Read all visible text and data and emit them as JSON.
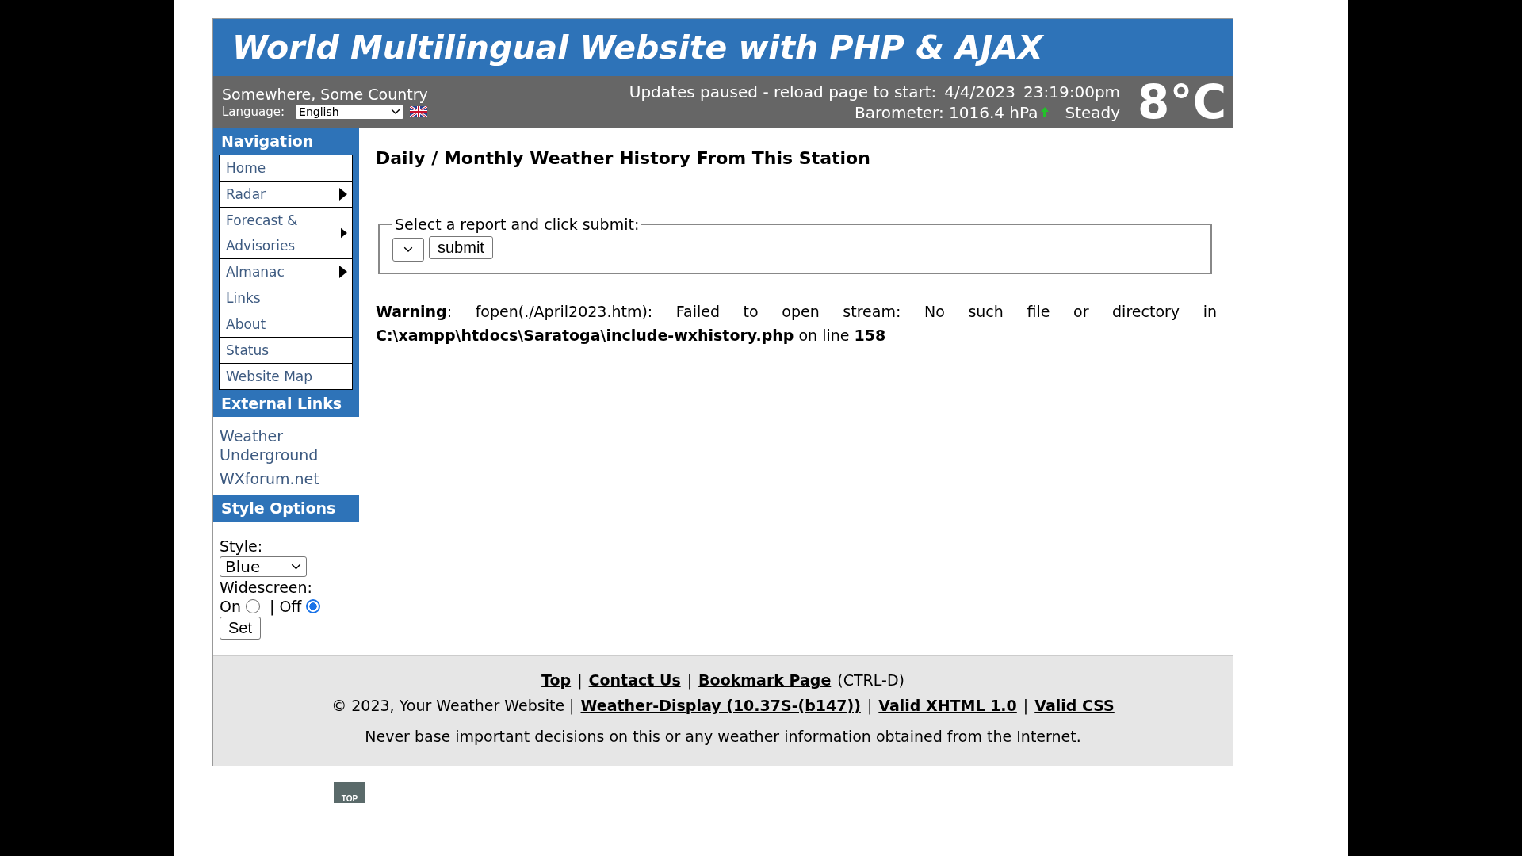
{
  "header": {
    "title": "World Multilingual Website with PHP & AJAX",
    "location": "Somewhere, Some Country",
    "language_label": "Language:",
    "language": "English",
    "status": "Updates paused - reload page to start:",
    "date": "4/4/2023",
    "time": "23:19:00pm",
    "barometer": "Barometer: 1016.4 hPa",
    "trend": "Steady",
    "temperature": "8°C"
  },
  "navigation": {
    "heading": "Navigation",
    "items": [
      {
        "label": "Home",
        "has_submenu": false
      },
      {
        "label": "Radar",
        "has_submenu": true
      },
      {
        "label": "Forecast & Advisories",
        "has_submenu": true
      },
      {
        "label": "Almanac",
        "has_submenu": true
      },
      {
        "label": "Links",
        "has_submenu": false
      },
      {
        "label": "About",
        "has_submenu": false
      },
      {
        "label": "Status",
        "has_submenu": false
      },
      {
        "label": "Website Map",
        "has_submenu": false
      }
    ]
  },
  "external_links": {
    "heading": "External Links",
    "links": [
      "Weather Underground",
      "WXforum.net"
    ]
  },
  "style_options": {
    "heading": "Style Options",
    "style_label": "Style:",
    "style": "Blue",
    "widescreen_label": "Widescreen:",
    "separator": "|",
    "options": [
      {
        "label": "On",
        "selected": false
      },
      {
        "label": "Off",
        "selected": true
      }
    ],
    "set_button": "Set"
  },
  "content": {
    "title": "Daily / Monthly Weather History From This Station",
    "legend": "Select a report and click submit:",
    "submit": "submit",
    "warning": "**Warning**: fopen(./April2023.htm): Failed to open stream: No such file or directory in **C:\\xampp\\htdocs\\Saratoga\\include-wxhistory.php** on line **158**"
  },
  "footer": {
    "lines": [
      [
        {
          "kind": "link",
          "text": "Top"
        },
        {
          "kind": "text",
          "text": "|"
        },
        {
          "kind": "link",
          "text": "Contact Us"
        },
        {
          "kind": "text",
          "text": "|"
        },
        {
          "kind": "link",
          "text": "Bookmark Page"
        },
        {
          "kind": "text",
          "text": "(CTRL-D)"
        }
      ],
      [
        {
          "kind": "text",
          "text": "© 2023, Your Weather Website |"
        },
        {
          "kind": "link",
          "text": "Weather-Display (10.37S-(b147))"
        },
        {
          "kind": "text",
          "text": "|"
        },
        {
          "kind": "link",
          "text": "Valid XHTML 1.0"
        },
        {
          "kind": "text",
          "text": "|"
        },
        {
          "kind": "link",
          "text": "Valid CSS"
        }
      ]
    ],
    "disclaimer": "Never base important decisions on this or any weather information obtained from the Internet."
  },
  "top_button": "TOP"
}
